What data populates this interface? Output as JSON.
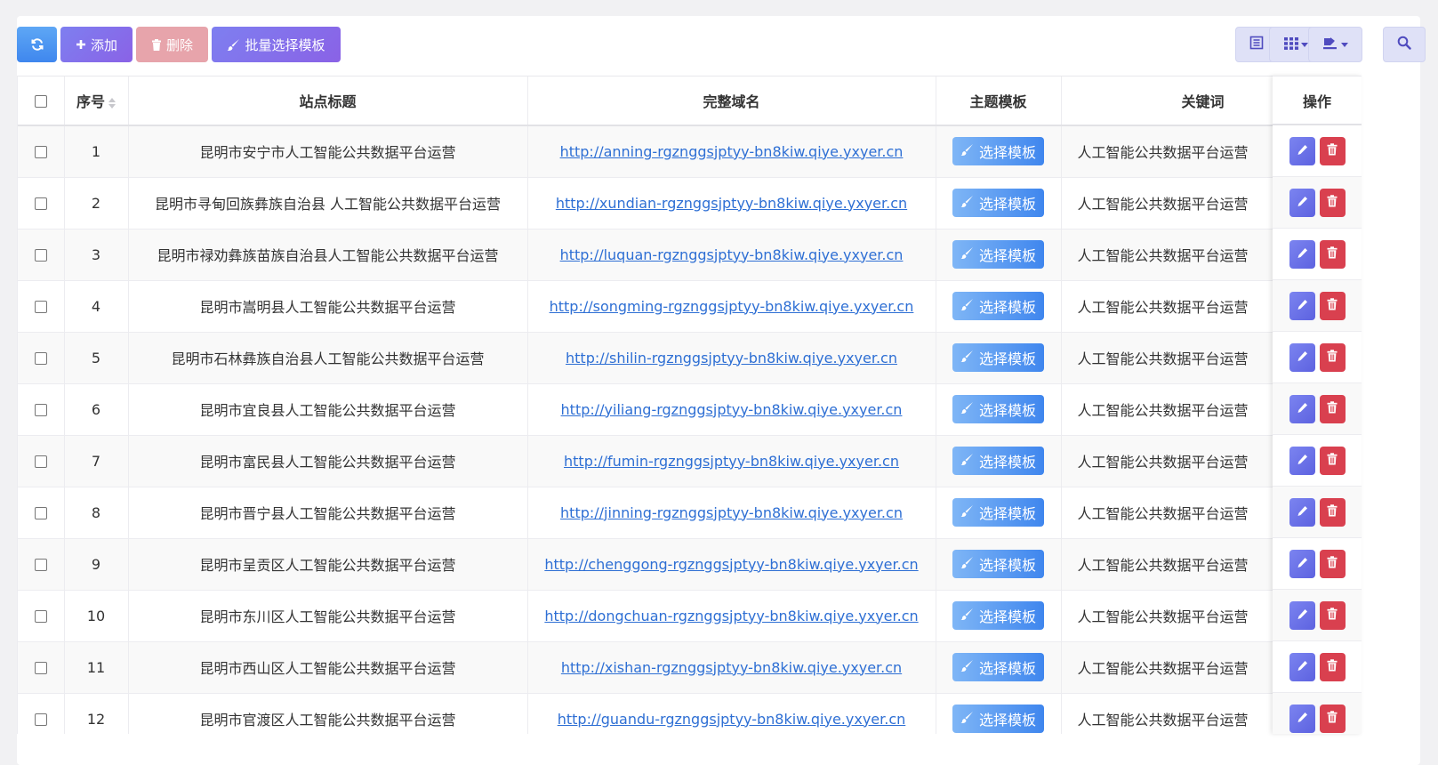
{
  "toolbar": {
    "add_label": "添加",
    "delete_label": "删除",
    "batch_label": "批量选择模板"
  },
  "table": {
    "headers": {
      "index": "序号",
      "title": "站点标题",
      "domain": "完整域名",
      "template": "主题模板",
      "keyword": "关键词",
      "actions": "操作"
    },
    "template_button_label": "选择模板",
    "rows": [
      {
        "index": "1",
        "title": "昆明市安宁市人工智能公共数据平台运营",
        "domain": "http://anning-rgznggsjptyy-bn8kiw.qiye.yxyer.cn",
        "keyword": "人工智能公共数据平台运营"
      },
      {
        "index": "2",
        "title": "昆明市寻甸回族彝族自治县 人工智能公共数据平台运营",
        "domain": "http://xundian-rgznggsjptyy-bn8kiw.qiye.yxyer.cn",
        "keyword": "人工智能公共数据平台运营"
      },
      {
        "index": "3",
        "title": "昆明市禄劝彝族苗族自治县人工智能公共数据平台运营",
        "domain": "http://luquan-rgznggsjptyy-bn8kiw.qiye.yxyer.cn",
        "keyword": "人工智能公共数据平台运营"
      },
      {
        "index": "4",
        "title": "昆明市嵩明县人工智能公共数据平台运营",
        "domain": "http://songming-rgznggsjptyy-bn8kiw.qiye.yxyer.cn",
        "keyword": "人工智能公共数据平台运营"
      },
      {
        "index": "5",
        "title": "昆明市石林彝族自治县人工智能公共数据平台运营",
        "domain": "http://shilin-rgznggsjptyy-bn8kiw.qiye.yxyer.cn",
        "keyword": "人工智能公共数据平台运营"
      },
      {
        "index": "6",
        "title": "昆明市宜良县人工智能公共数据平台运营",
        "domain": "http://yiliang-rgznggsjptyy-bn8kiw.qiye.yxyer.cn",
        "keyword": "人工智能公共数据平台运营"
      },
      {
        "index": "7",
        "title": "昆明市富民县人工智能公共数据平台运营",
        "domain": "http://fumin-rgznggsjptyy-bn8kiw.qiye.yxyer.cn",
        "keyword": "人工智能公共数据平台运营"
      },
      {
        "index": "8",
        "title": "昆明市晋宁县人工智能公共数据平台运营",
        "domain": "http://jinning-rgznggsjptyy-bn8kiw.qiye.yxyer.cn",
        "keyword": "人工智能公共数据平台运营"
      },
      {
        "index": "9",
        "title": "昆明市呈贡区人工智能公共数据平台运营",
        "domain": "http://chenggong-rgznggsjptyy-bn8kiw.qiye.yxyer.cn",
        "keyword": "人工智能公共数据平台运营"
      },
      {
        "index": "10",
        "title": "昆明市东川区人工智能公共数据平台运营",
        "domain": "http://dongchuan-rgznggsjptyy-bn8kiw.qiye.yxyer.cn",
        "keyword": "人工智能公共数据平台运营"
      },
      {
        "index": "11",
        "title": "昆明市西山区人工智能公共数据平台运营",
        "domain": "http://xishan-rgznggsjptyy-bn8kiw.qiye.yxyer.cn",
        "keyword": "人工智能公共数据平台运营"
      },
      {
        "index": "12",
        "title": "昆明市官渡区人工智能公共数据平台运营",
        "domain": "http://guandu-rgznggsjptyy-bn8kiw.qiye.yxyer.cn",
        "keyword": "人工智能公共数据平台运营"
      }
    ]
  },
  "icons": {
    "refresh": "refresh-icon",
    "add": "plus-icon",
    "delete": "trash-icon",
    "batch": "brush-icon",
    "list_view": "list-view-icon",
    "columns": "grid-columns-icon",
    "export": "export-icon",
    "search": "search-icon",
    "edit": "pencil-icon",
    "row_delete": "trash-icon"
  },
  "colors": {
    "primary_blue": "#3f87ee",
    "purple": "#8a62e6",
    "danger": "#d9404f",
    "link": "#2e6fd4"
  }
}
